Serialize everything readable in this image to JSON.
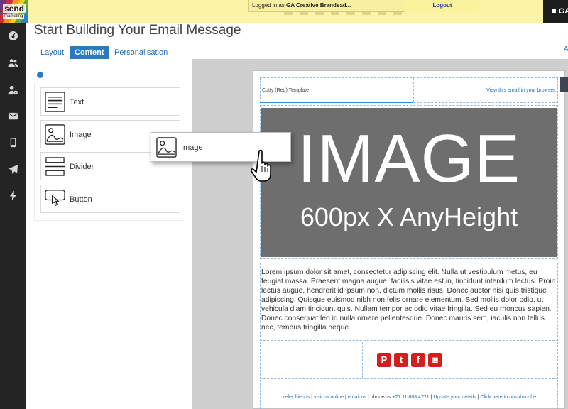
{
  "app": {
    "logo_text": "send",
    "logo_sub": "marketing"
  },
  "topbar": {
    "login_prefix": "Logged in as",
    "login_user": "GA Creative Brandsad...",
    "logout_label": "Logout",
    "user_button_label": "GA"
  },
  "sidebar": {
    "items": [
      {
        "icon": "dashboard-icon"
      },
      {
        "icon": "users-icon"
      },
      {
        "icon": "user-settings-icon"
      },
      {
        "icon": "email-icon"
      },
      {
        "icon": "mobile-icon"
      },
      {
        "icon": "send-icon"
      },
      {
        "icon": "lightning-icon"
      }
    ]
  },
  "page": {
    "title": "Start Building Your Email Message",
    "right_edge_text": "A"
  },
  "tabs": [
    {
      "label": "Layout",
      "active": false
    },
    {
      "label": "Content",
      "active": true
    },
    {
      "label": "Personalisation",
      "active": false
    }
  ],
  "content_blocks": [
    {
      "label": "Text",
      "icon": "text-block-icon"
    },
    {
      "label": "Image",
      "icon": "image-block-icon"
    },
    {
      "label": "Divider",
      "icon": "divider-block-icon"
    },
    {
      "label": "Button",
      "icon": "button-block-icon"
    }
  ],
  "drag_preview": {
    "label": "Image",
    "icon": "image-block-icon"
  },
  "email": {
    "template_name": "Cutty (Red) Template",
    "view_in_browser": "View this email in your browser.",
    "hero_big": "IMAGE",
    "hero_small": "600px X AnyHeight",
    "body_text": "Lorem ipsum dolor sit amet, consectetur adipiscing elit. Nulla ut vestibulum metus, eu feugiat massa. Praesent magna augue, facilisis vitae est in, tincidunt interdum lectus. Proin lectus augue, hendrerit id ipsum non, dictum mollis risus. Donec auctor nisi quis tristique adipiscing. Quisque euismod nibh non felis ornare elementum. Sed mollis dolor odio, ut vehicula diam tincidunt quis. Nullam tempor ac odio vitae fringilla. Sed eu rhoncus sapien. Donec consequat leo id nulla ornare pellentesque. Donec mauris sem, iaculis non tellus nec, tempus fringilla neque.",
    "social_icons": [
      {
        "name": "pinterest-icon",
        "glyph": "P"
      },
      {
        "name": "twitter-icon",
        "glyph": "t"
      },
      {
        "name": "facebook-icon",
        "glyph": "f"
      },
      {
        "name": "instagram-icon",
        "glyph": "◙"
      }
    ],
    "footer": {
      "refer": "refer friends",
      "visit": "visit us online",
      "email": "email us",
      "phone_label": "phone us",
      "phone": "+27 11 608 4721",
      "update": "Update your details",
      "unsubscribe": "Click here to unsubscribe"
    }
  },
  "colors": {
    "topbar_bg": "#fbf3a5",
    "sidebar_bg": "#242424",
    "accent": "#2a7abf",
    "hero_bg": "#6e6e6e",
    "social_red": "#d41f1f"
  }
}
